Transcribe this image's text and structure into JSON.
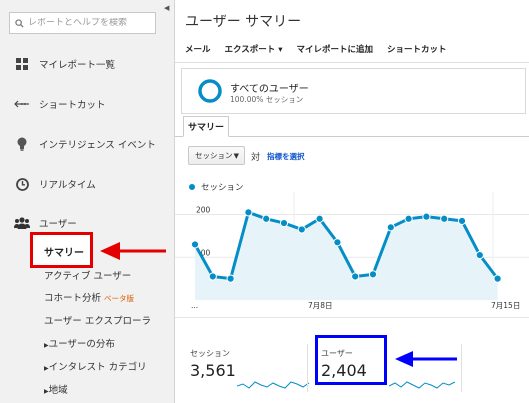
{
  "search": {
    "placeholder": "レポートとヘルプを検索"
  },
  "nav": [
    {
      "label": "マイレポート一覧",
      "icon": "grid-icon"
    },
    {
      "label": "ショートカット",
      "icon": "shortcut-arrow-icon"
    },
    {
      "label": "インテリジェンス イベント",
      "icon": "lightbulb-icon"
    },
    {
      "label": "リアルタイム",
      "icon": "clock-icon"
    },
    {
      "label": "ユーザー",
      "icon": "users-icon"
    }
  ],
  "user_sub": {
    "summary": "サマリー",
    "active_users": "アクティブ ユーザー",
    "cohort": "コホート分析",
    "beta": "ベータ版",
    "user_explorer": "ユーザー エクスプローラ",
    "user_distribution": "ユーザーの分布",
    "interest_category": "インタレスト カテゴリ",
    "region": "地域"
  },
  "main": {
    "title": "ユーザー サマリー",
    "toolbar": [
      "メール",
      "エクスポート ▾",
      "マイレポートに追加",
      "ショートカット"
    ],
    "segment_name": "すべてのユーザー",
    "segment_pct": "100.00% セッション",
    "tab": "サマリー",
    "metric_select": "セッション",
    "vs": "対",
    "pick_metric": "指標を選択",
    "legend": "セッション"
  },
  "chart_data": {
    "type": "line",
    "series": [
      {
        "name": "セッション",
        "values": [
          130,
          55,
          50,
          205,
          190,
          180,
          165,
          190,
          135,
          55,
          60,
          170,
          190,
          195,
          190,
          185,
          105,
          50
        ]
      }
    ],
    "y_ticks": [
      "200",
      "100"
    ],
    "x_labels": [
      "...",
      "7月8日",
      "7月15日"
    ],
    "ylim": [
      0,
      240
    ],
    "color": "#058dc7"
  },
  "metrics": [
    {
      "label": "セッション",
      "value": "3,561"
    },
    {
      "label": "ユーザー",
      "value": "2,404"
    }
  ],
  "annotation_colors": {
    "red": "#e40000",
    "blue": "#0000ff"
  }
}
